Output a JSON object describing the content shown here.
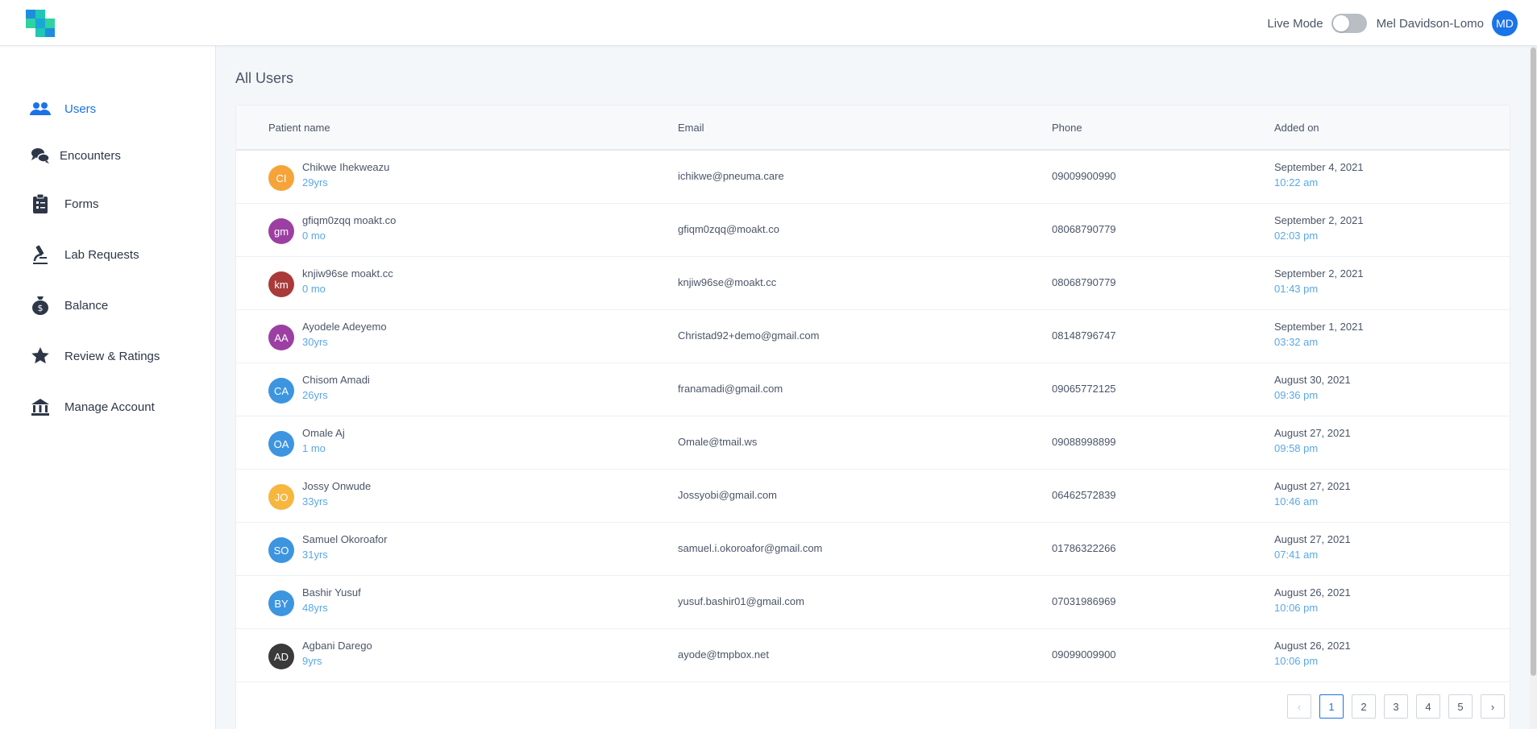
{
  "header": {
    "live_mode_label": "Live Mode",
    "live_mode_on": false,
    "user_name": "Mel Davidson-Lomo",
    "user_initials": "MD"
  },
  "sidebar": {
    "items": [
      {
        "label": "Users",
        "icon": "users-icon",
        "active": true
      },
      {
        "label": "Encounters",
        "icon": "chat-bubbles-icon",
        "active": false
      },
      {
        "label": "Forms",
        "icon": "clipboard-icon",
        "active": false
      },
      {
        "label": "Lab Requests",
        "icon": "microscope-icon",
        "active": false
      },
      {
        "label": "Balance",
        "icon": "money-bag-icon",
        "active": false
      },
      {
        "label": "Review & Ratings",
        "icon": "star-icon",
        "active": false
      },
      {
        "label": "Manage Account",
        "icon": "bank-icon",
        "active": false
      }
    ]
  },
  "main": {
    "title": "All Users",
    "columns": {
      "name": "Patient name",
      "email": "Email",
      "phone": "Phone",
      "added": "Added on"
    },
    "rows": [
      {
        "initials": "CI",
        "color": "#f6a43a",
        "name": "Chikwe Ihekweazu",
        "age": "29yrs",
        "email": "ichikwe@pneuma.care",
        "phone": "09009900990",
        "date": "September 4, 2021",
        "time": "10:22 am"
      },
      {
        "initials": "gm",
        "color": "#9c3fa3",
        "name": "gfiqm0zqq moakt.co",
        "age": "0 mo",
        "email": "gfiqm0zqq@moakt.co",
        "phone": "08068790779",
        "date": "September 2, 2021",
        "time": "02:03 pm"
      },
      {
        "initials": "km",
        "color": "#a93a3a",
        "name": "knjiw96se moakt.cc",
        "age": "0 mo",
        "email": "knjiw96se@moakt.cc",
        "phone": "08068790779",
        "date": "September 2, 2021",
        "time": "01:43 pm"
      },
      {
        "initials": "AA",
        "color": "#9c3fa3",
        "name": "Ayodele Adeyemo",
        "age": "30yrs",
        "email": "Christad92+demo@gmail.com",
        "phone": "08148796747",
        "date": "September 1, 2021",
        "time": "03:32 am"
      },
      {
        "initials": "CA",
        "color": "#3d95e0",
        "name": "Chisom Amadi",
        "age": "26yrs",
        "email": "franamadi@gmail.com",
        "phone": "09065772125",
        "date": "August 30, 2021",
        "time": "09:36 pm"
      },
      {
        "initials": "OA",
        "color": "#3d95e0",
        "name": "Omale Aj",
        "age": "1 mo",
        "email": "Omale@tmail.ws",
        "phone": "09088998899",
        "date": "August 27, 2021",
        "time": "09:58 pm"
      },
      {
        "initials": "JO",
        "color": "#f7b63e",
        "name": "Jossy Onwude",
        "age": "33yrs",
        "email": "Jossyobi@gmail.com",
        "phone": "06462572839",
        "date": "August 27, 2021",
        "time": "10:46 am"
      },
      {
        "initials": "SO",
        "color": "#3d95e0",
        "name": "Samuel Okoroafor",
        "age": "31yrs",
        "email": "samuel.i.okoroafor@gmail.com",
        "phone": "01786322266",
        "date": "August 27, 2021",
        "time": "07:41 am"
      },
      {
        "initials": "BY",
        "color": "#3d95e0",
        "name": "Bashir Yusuf",
        "age": "48yrs",
        "email": "yusuf.bashir01@gmail.com",
        "phone": "07031986969",
        "date": "August 26, 2021",
        "time": "10:06 pm"
      },
      {
        "initials": "AD",
        "color": "#3a3a3a",
        "name": "Agbani Darego",
        "age": "9yrs",
        "email": "ayode@tmpbox.net",
        "phone": "09099009900",
        "date": "August 26, 2021",
        "time": "10:06 pm"
      }
    ]
  },
  "pagination": {
    "prev": "‹",
    "next": "›",
    "pages": [
      "1",
      "2",
      "3",
      "4",
      "5"
    ],
    "current": "1"
  }
}
